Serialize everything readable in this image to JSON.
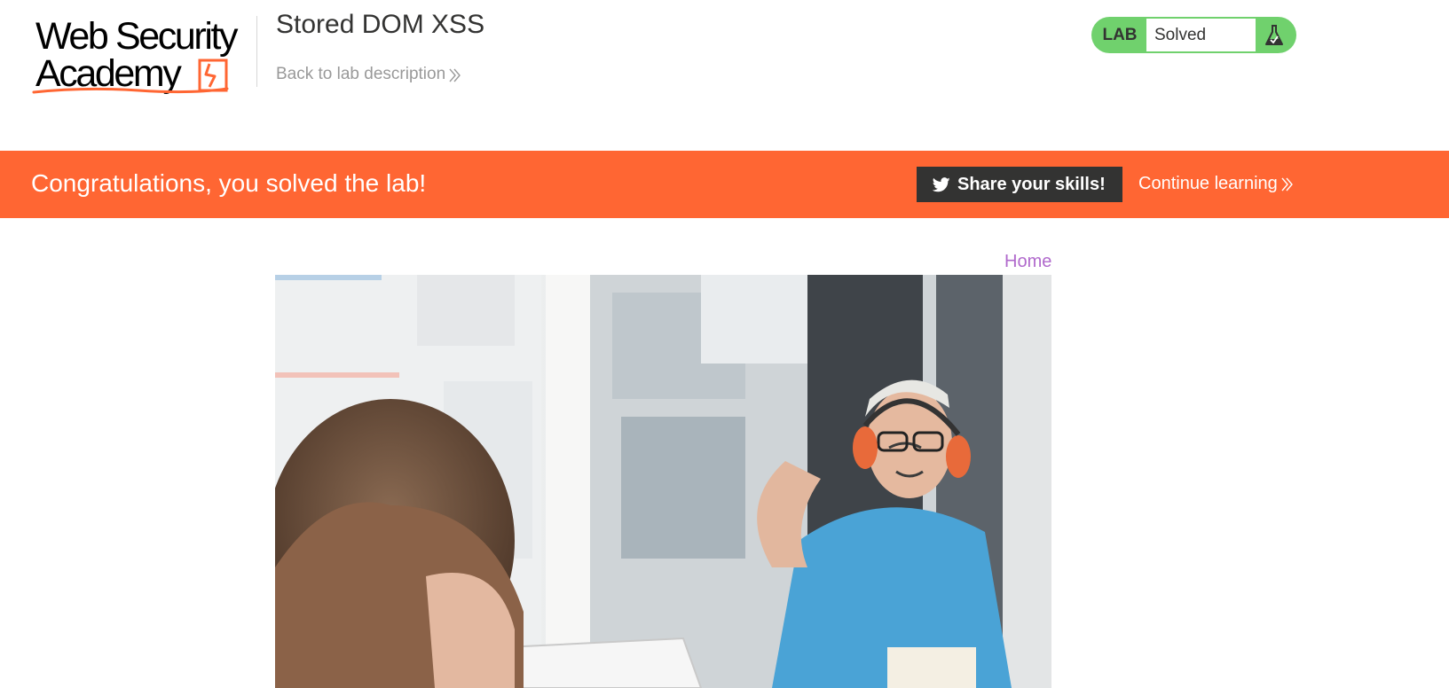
{
  "header": {
    "logo_line1": "Web Security",
    "logo_line2": "Academy",
    "lab_title": "Stored DOM XSS",
    "back_link": "Back to lab description",
    "lab_tag": "LAB",
    "status": "Solved",
    "status_color": "#70d16d"
  },
  "banner": {
    "message": "Congratulations, you solved the lab!",
    "share_label": "Share your skills!",
    "continue_label": "Continue learning",
    "background": "#ff6633"
  },
  "nav": {
    "home_label": "Home"
  },
  "post": {
    "image_subject": "blog-post-image"
  },
  "icons": {
    "share": "twitter-bird-icon",
    "continue": "double-chevron-right-icon",
    "back": "double-chevron-right-icon",
    "status": "flask-icon"
  }
}
